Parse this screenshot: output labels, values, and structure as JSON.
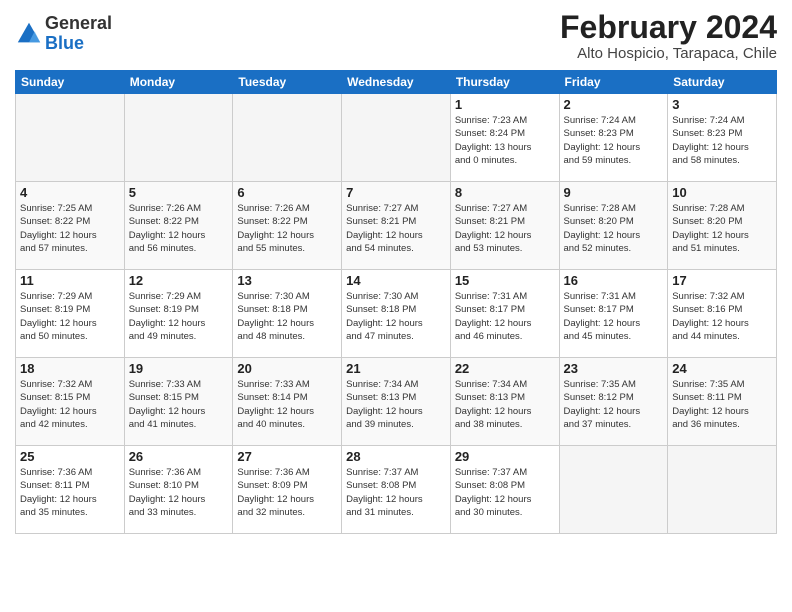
{
  "header": {
    "logo_general": "General",
    "logo_blue": "Blue",
    "month_title": "February 2024",
    "location": "Alto Hospicio, Tarapaca, Chile"
  },
  "weekdays": [
    "Sunday",
    "Monday",
    "Tuesday",
    "Wednesday",
    "Thursday",
    "Friday",
    "Saturday"
  ],
  "weeks": [
    [
      {
        "day": "",
        "info": ""
      },
      {
        "day": "",
        "info": ""
      },
      {
        "day": "",
        "info": ""
      },
      {
        "day": "",
        "info": ""
      },
      {
        "day": "1",
        "info": "Sunrise: 7:23 AM\nSunset: 8:24 PM\nDaylight: 13 hours\nand 0 minutes."
      },
      {
        "day": "2",
        "info": "Sunrise: 7:24 AM\nSunset: 8:23 PM\nDaylight: 12 hours\nand 59 minutes."
      },
      {
        "day": "3",
        "info": "Sunrise: 7:24 AM\nSunset: 8:23 PM\nDaylight: 12 hours\nand 58 minutes."
      }
    ],
    [
      {
        "day": "4",
        "info": "Sunrise: 7:25 AM\nSunset: 8:22 PM\nDaylight: 12 hours\nand 57 minutes."
      },
      {
        "day": "5",
        "info": "Sunrise: 7:26 AM\nSunset: 8:22 PM\nDaylight: 12 hours\nand 56 minutes."
      },
      {
        "day": "6",
        "info": "Sunrise: 7:26 AM\nSunset: 8:22 PM\nDaylight: 12 hours\nand 55 minutes."
      },
      {
        "day": "7",
        "info": "Sunrise: 7:27 AM\nSunset: 8:21 PM\nDaylight: 12 hours\nand 54 minutes."
      },
      {
        "day": "8",
        "info": "Sunrise: 7:27 AM\nSunset: 8:21 PM\nDaylight: 12 hours\nand 53 minutes."
      },
      {
        "day": "9",
        "info": "Sunrise: 7:28 AM\nSunset: 8:20 PM\nDaylight: 12 hours\nand 52 minutes."
      },
      {
        "day": "10",
        "info": "Sunrise: 7:28 AM\nSunset: 8:20 PM\nDaylight: 12 hours\nand 51 minutes."
      }
    ],
    [
      {
        "day": "11",
        "info": "Sunrise: 7:29 AM\nSunset: 8:19 PM\nDaylight: 12 hours\nand 50 minutes."
      },
      {
        "day": "12",
        "info": "Sunrise: 7:29 AM\nSunset: 8:19 PM\nDaylight: 12 hours\nand 49 minutes."
      },
      {
        "day": "13",
        "info": "Sunrise: 7:30 AM\nSunset: 8:18 PM\nDaylight: 12 hours\nand 48 minutes."
      },
      {
        "day": "14",
        "info": "Sunrise: 7:30 AM\nSunset: 8:18 PM\nDaylight: 12 hours\nand 47 minutes."
      },
      {
        "day": "15",
        "info": "Sunrise: 7:31 AM\nSunset: 8:17 PM\nDaylight: 12 hours\nand 46 minutes."
      },
      {
        "day": "16",
        "info": "Sunrise: 7:31 AM\nSunset: 8:17 PM\nDaylight: 12 hours\nand 45 minutes."
      },
      {
        "day": "17",
        "info": "Sunrise: 7:32 AM\nSunset: 8:16 PM\nDaylight: 12 hours\nand 44 minutes."
      }
    ],
    [
      {
        "day": "18",
        "info": "Sunrise: 7:32 AM\nSunset: 8:15 PM\nDaylight: 12 hours\nand 42 minutes."
      },
      {
        "day": "19",
        "info": "Sunrise: 7:33 AM\nSunset: 8:15 PM\nDaylight: 12 hours\nand 41 minutes."
      },
      {
        "day": "20",
        "info": "Sunrise: 7:33 AM\nSunset: 8:14 PM\nDaylight: 12 hours\nand 40 minutes."
      },
      {
        "day": "21",
        "info": "Sunrise: 7:34 AM\nSunset: 8:13 PM\nDaylight: 12 hours\nand 39 minutes."
      },
      {
        "day": "22",
        "info": "Sunrise: 7:34 AM\nSunset: 8:13 PM\nDaylight: 12 hours\nand 38 minutes."
      },
      {
        "day": "23",
        "info": "Sunrise: 7:35 AM\nSunset: 8:12 PM\nDaylight: 12 hours\nand 37 minutes."
      },
      {
        "day": "24",
        "info": "Sunrise: 7:35 AM\nSunset: 8:11 PM\nDaylight: 12 hours\nand 36 minutes."
      }
    ],
    [
      {
        "day": "25",
        "info": "Sunrise: 7:36 AM\nSunset: 8:11 PM\nDaylight: 12 hours\nand 35 minutes."
      },
      {
        "day": "26",
        "info": "Sunrise: 7:36 AM\nSunset: 8:10 PM\nDaylight: 12 hours\nand 33 minutes."
      },
      {
        "day": "27",
        "info": "Sunrise: 7:36 AM\nSunset: 8:09 PM\nDaylight: 12 hours\nand 32 minutes."
      },
      {
        "day": "28",
        "info": "Sunrise: 7:37 AM\nSunset: 8:08 PM\nDaylight: 12 hours\nand 31 minutes."
      },
      {
        "day": "29",
        "info": "Sunrise: 7:37 AM\nSunset: 8:08 PM\nDaylight: 12 hours\nand 30 minutes."
      },
      {
        "day": "",
        "info": ""
      },
      {
        "day": "",
        "info": ""
      }
    ]
  ]
}
